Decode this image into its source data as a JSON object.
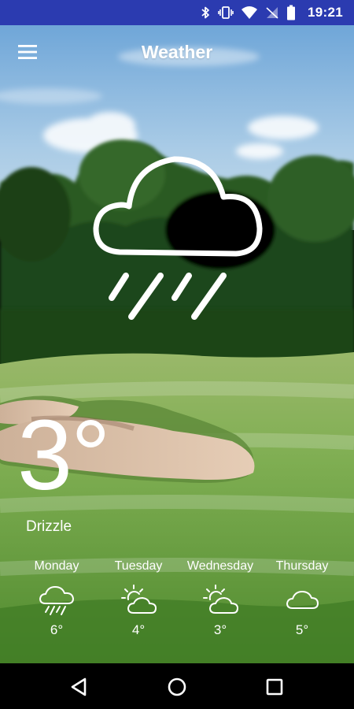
{
  "status_bar": {
    "time": "19:21",
    "icons": [
      "bluetooth-icon",
      "vibrate-icon",
      "wifi-icon",
      "no-signal-icon",
      "battery-icon"
    ],
    "background": "#2b3bb0"
  },
  "app_bar": {
    "title": "Weather",
    "menu_icon": "hamburger-menu-icon"
  },
  "current": {
    "icon": "rain-cloud-icon",
    "temperature": "3°",
    "condition": "Drizzle"
  },
  "forecast": [
    {
      "day": "Monday",
      "icon": "drizzle-icon",
      "temp": "6°"
    },
    {
      "day": "Tuesday",
      "icon": "partly-sunny-icon",
      "temp": "4°"
    },
    {
      "day": "Wednesday",
      "icon": "partly-sunny-icon",
      "temp": "3°"
    },
    {
      "day": "Thursday",
      "icon": "cloud-icon",
      "temp": "5°"
    }
  ],
  "nav_bar": {
    "buttons": [
      "back-icon",
      "home-icon",
      "recents-icon"
    ]
  },
  "colors": {
    "sky": "#8fbde0",
    "grass": "#6fa048",
    "trees": "#1f4a1c",
    "sand": "#ddc2a8",
    "text": "#ffffff"
  }
}
